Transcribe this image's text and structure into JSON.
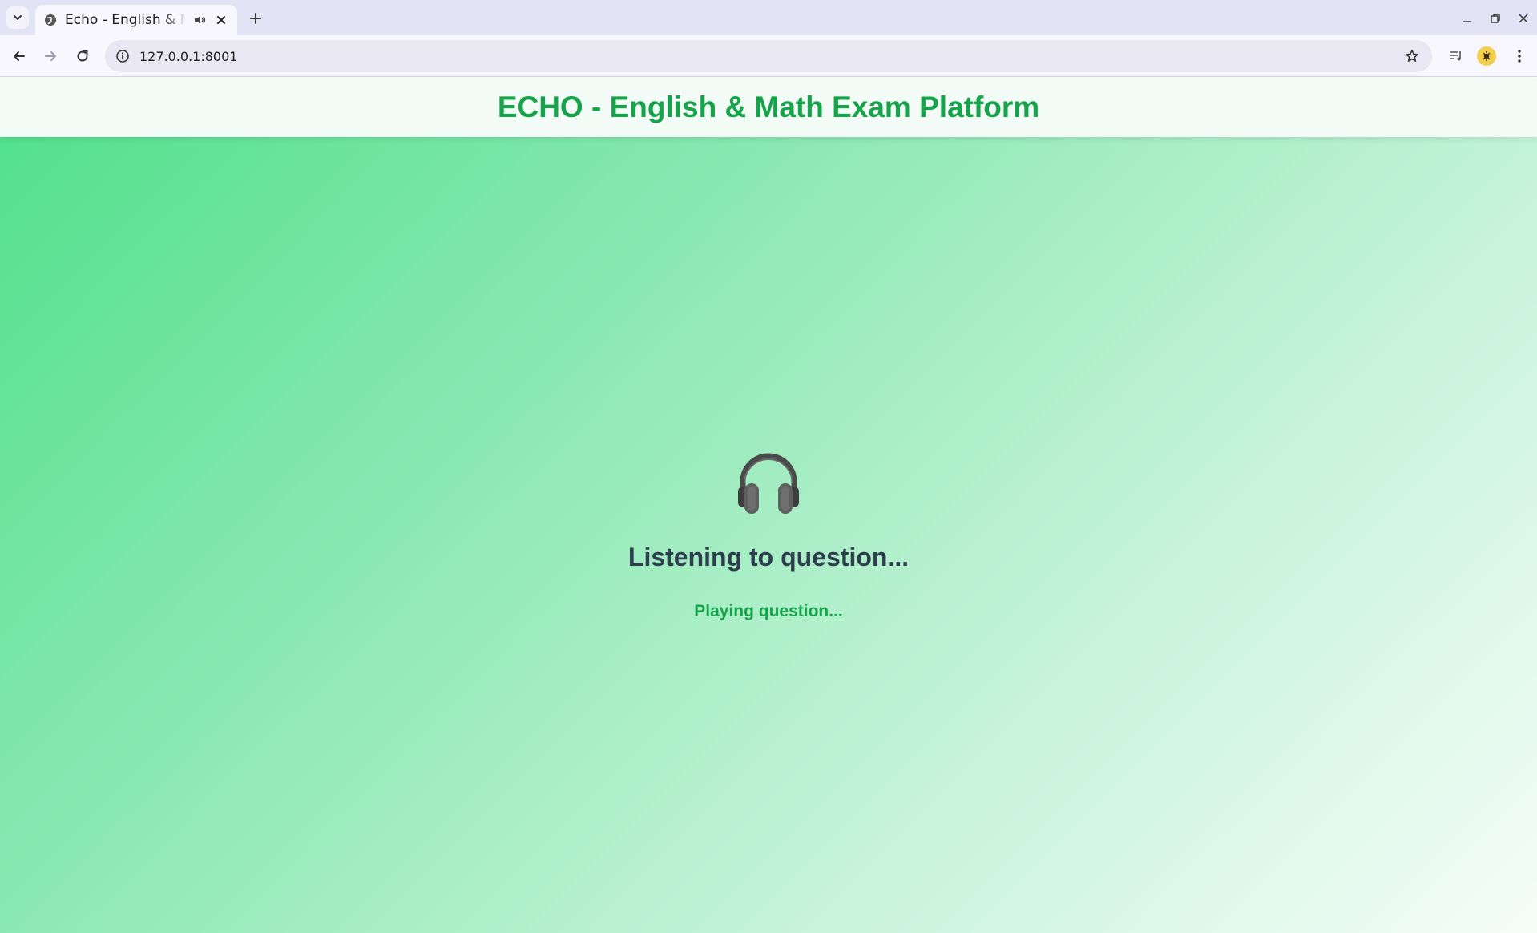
{
  "browser": {
    "tab": {
      "title": "Echo - English & Math Exam Platform",
      "audio_icon": "speaker-icon"
    },
    "address_bar": {
      "url": "127.0.0.1:8001"
    },
    "icons": {
      "tab_list": "chevron-down-icon",
      "favicon": "globe-icon",
      "close": "close-icon",
      "new_tab": "plus-icon",
      "back": "back-arrow-icon",
      "forward": "forward-arrow-icon",
      "reload": "reload-icon",
      "site_info": "info-icon",
      "bookmark": "star-icon",
      "media": "media-control-icon",
      "profile": "profile-avatar",
      "menu": "kebab-menu-icon",
      "minimize": "minimize-icon",
      "restore": "restore-icon",
      "window_close": "close-icon"
    }
  },
  "header": {
    "title": "ECHO - English & Math Exam Platform"
  },
  "status": {
    "icon": "headphones-icon",
    "title": "Listening to question...",
    "subtitle": "Playing question..."
  },
  "colors": {
    "brand_green": "#17a34a",
    "heading_dark": "#2f3e4f",
    "gradient_start": "#4fe08a",
    "gradient_end": "#f6fdf9"
  }
}
